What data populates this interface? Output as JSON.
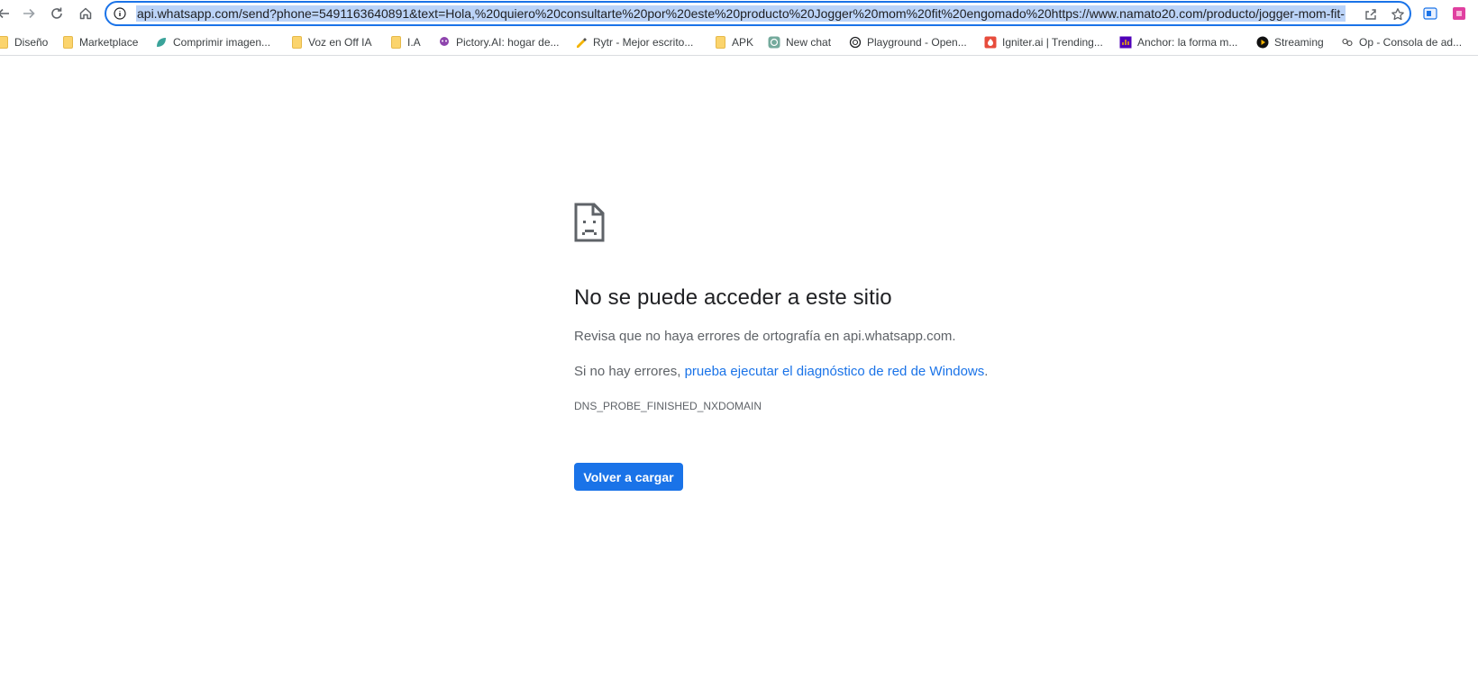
{
  "browser": {
    "url": "api.whatsapp.com/send?phone=5491163640891&text=Hola,%20quiero%20consultarte%20por%20este%20producto%20Jogger%20mom%20fit%20engomado%20https://www.namato20.com/producto/jogger-mom-fit-",
    "nav_icons": [
      "back-icon",
      "forward-icon",
      "reload-icon",
      "home-icon"
    ],
    "accent_color": "#1a73e8"
  },
  "bookmarks": [
    {
      "label": "Diseño",
      "icon": "folder-icon"
    },
    {
      "label": "Marketplace",
      "icon": "folder-icon"
    },
    {
      "label": "Comprimir imagen...",
      "icon": "leaf-icon"
    },
    {
      "label": "Voz en Off IA",
      "icon": "folder-icon"
    },
    {
      "label": "I.A",
      "icon": "folder-icon"
    },
    {
      "label": "Pictory.AI: hogar de...",
      "icon": "octopus-icon"
    },
    {
      "label": "Rytr - Mejor escrito...",
      "icon": "pen-hand-icon"
    },
    {
      "label": "APK",
      "icon": "folder-icon"
    },
    {
      "label": "New chat",
      "icon": "openai-icon"
    },
    {
      "label": "Playground - Open...",
      "icon": "openai-icon"
    },
    {
      "label": "Igniter.ai | Trending...",
      "icon": "igniter-icon"
    },
    {
      "label": "Anchor: la forma m...",
      "icon": "anchor-icon"
    },
    {
      "label": "Streaming",
      "icon": "streaming-icon"
    },
    {
      "label": "Op - Consola de ad...",
      "icon": "op-icon"
    }
  ],
  "error": {
    "title": "No se puede acceder a este sitio",
    "line1": "Revisa que no haya errores de ortografía en api.whatsapp.com.",
    "line2_prefix": "Si no hay errores, ",
    "line2_link": "prueba ejecutar el diagnóstico de red de Windows",
    "line2_suffix": ".",
    "code": "DNS_PROBE_FINISHED_NXDOMAIN",
    "reload_label": "Volver a cargar",
    "icon": "sad-page-icon"
  }
}
